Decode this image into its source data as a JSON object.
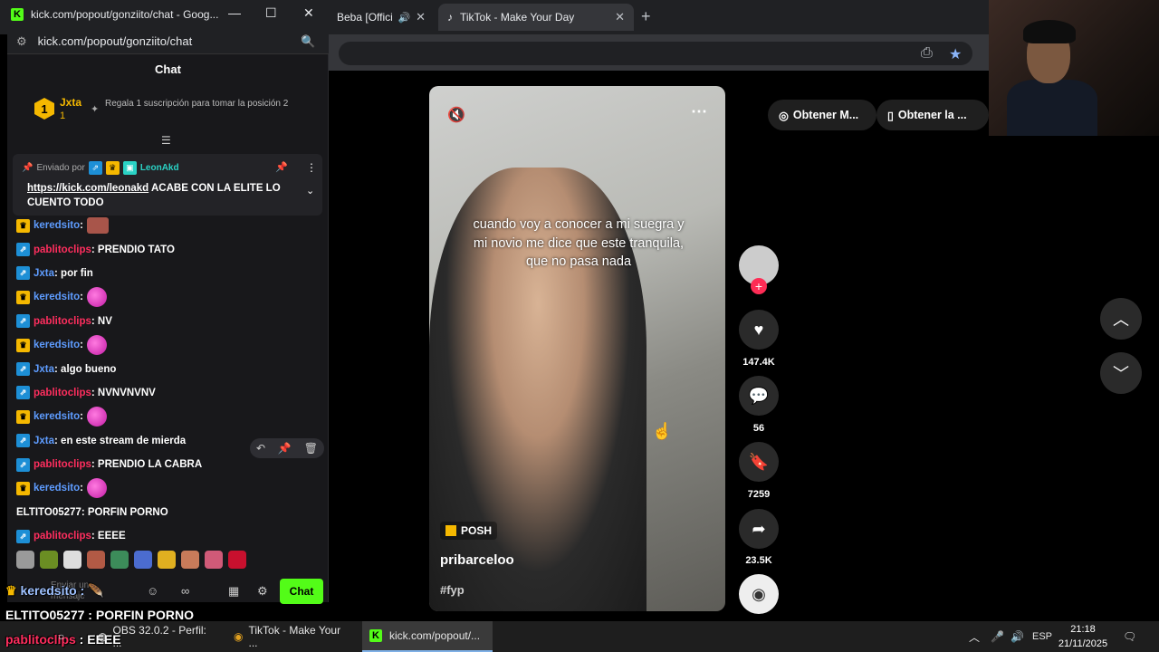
{
  "chrome": {
    "tabs": [
      {
        "label": "Beba [Offici"
      },
      {
        "label": "TikTok - Make Your Day"
      }
    ]
  },
  "chat_window": {
    "title": "kick.com/popout/gonziito/chat - Goog...",
    "url": "kick.com/popout/gonziito/chat",
    "header": "Chat",
    "leader": {
      "rank": "1",
      "name": "Jxta",
      "count": "1",
      "note": "Regala 1 suscripción para tomar la posición 2"
    },
    "pinned": {
      "sent_by": "Enviado por",
      "user": "LeonAkd",
      "link": "https://kick.com/leonakd",
      "text": " ACABE CON LA ELITE LO CUENTO TODO"
    },
    "messages": [
      {
        "user": "keredsito",
        "color": "#5e9cff",
        "badge": "gold",
        "text": ":",
        "emote": "face"
      },
      {
        "user": "pablitoclips",
        "color": "#ff2e5e",
        "badge": "blue",
        "text": ": PRENDIO TATO"
      },
      {
        "user": "Jxta",
        "color": "#5e9cff",
        "badge": "blue",
        "text": ": por fin"
      },
      {
        "user": "keredsito",
        "color": "#5e9cff",
        "badge": "gold",
        "text": ":",
        "emote": "pink"
      },
      {
        "user": "pablitoclips",
        "color": "#ff2e5e",
        "badge": "blue",
        "text": ": NV"
      },
      {
        "user": "keredsito",
        "color": "#5e9cff",
        "badge": "gold",
        "text": ":",
        "emote": "pink"
      },
      {
        "user": "Jxta",
        "color": "#5e9cff",
        "badge": "blue",
        "text": ": algo bueno"
      },
      {
        "user": "pablitoclips",
        "color": "#ff2e5e",
        "badge": "blue",
        "text": ": NVNVNVNV"
      },
      {
        "user": "keredsito",
        "color": "#5e9cff",
        "badge": "gold",
        "text": ":",
        "emote": "pink"
      },
      {
        "user": "Jxta",
        "color": "#5e9cff",
        "badge": "blue",
        "text": ": en este stream de mierda"
      },
      {
        "user": "pablitoclips",
        "color": "#ff2e5e",
        "badge": "blue",
        "text": ": PRENDIO LA CABRA"
      },
      {
        "user": "keredsito",
        "color": "#5e9cff",
        "badge": "gold",
        "text": ":",
        "emote": "pink"
      },
      {
        "user": "ELTITO05277",
        "color": "#ffffff",
        "badge": "",
        "text": ": PORFIN PORNO"
      },
      {
        "user": "pablitoclips",
        "color": "#ff2e5e",
        "badge": "blue",
        "text": ": EEEE"
      }
    ],
    "input_placeholder": "Enviar un mensaje",
    "send_label": "Chat"
  },
  "tiktok": {
    "caption": "cuando voy a conocer a mi suegra y mi novio me dice que este tranquila, que no pasa nada",
    "tag": "POSH",
    "creator": "pribarceloo",
    "hashtag": "#fyp",
    "likes": "147.4K",
    "comments": "56",
    "saves": "7259",
    "shares": "23.5K",
    "pill_left": "Obtener M...",
    "pill_right": "Obtener la ..."
  },
  "overlay": {
    "line1_user": "keredsito :",
    "line2": "ELTITO05277 : PORFIN PORNO",
    "line3_user": "pablitoclips",
    "line3_text": " : EEEE"
  },
  "taskbar": {
    "obs": "OBS 32.0.2 - Perfil: ...",
    "tiktok": "TikTok - Make Your ...",
    "kick": "kick.com/popout/...",
    "lang": "ESP",
    "time": "21:18",
    "date": "21/11/2025"
  },
  "colors": {
    "kick_green": "#53fc18",
    "tiktok_bg": "#000000",
    "username_red": "#ff2e5e",
    "username_blue": "#5e9cff"
  }
}
